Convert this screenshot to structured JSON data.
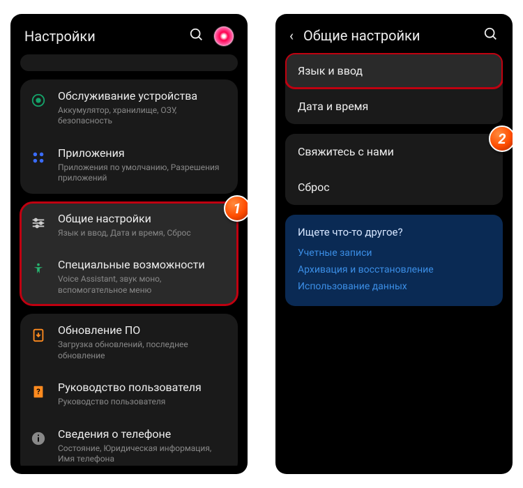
{
  "left": {
    "header": {
      "title": "Настройки"
    },
    "items": {
      "device_care": {
        "title": "Обслуживание устройства",
        "sub": "Аккумулятор, хранилище, ОЗУ, безопасность"
      },
      "apps": {
        "title": "Приложения",
        "sub": "Приложения по умолчанию, Разрешения приложений"
      },
      "general": {
        "title": "Общие настройки",
        "sub": "Язык и ввод, Дата и время, Сброс"
      },
      "accessibility": {
        "title": "Специальные возможности",
        "sub": "Voice Assistant, звук моно, вспомогательное меню"
      },
      "update": {
        "title": "Обновление ПО",
        "sub": "Загрузка обновлений, последнее обновление"
      },
      "manual": {
        "title": "Руководство пользователя",
        "sub": "Руководство пользователя"
      },
      "about": {
        "title": "Сведения о телефоне",
        "sub": "Состояние, Юридическая информация, Имя телефона"
      }
    },
    "badge": "1"
  },
  "right": {
    "header": {
      "title": "Общие настройки"
    },
    "rows": {
      "lang": "Язык и ввод",
      "date": "Дата и время",
      "contact": "Свяжитесь с нами",
      "reset": "Сброс"
    },
    "tips": {
      "title": "Ищете что-то другое?",
      "link1": "Учетные записи",
      "link2": "Архивация и восстановление",
      "link3": "Использование данных"
    },
    "badge": "2"
  }
}
